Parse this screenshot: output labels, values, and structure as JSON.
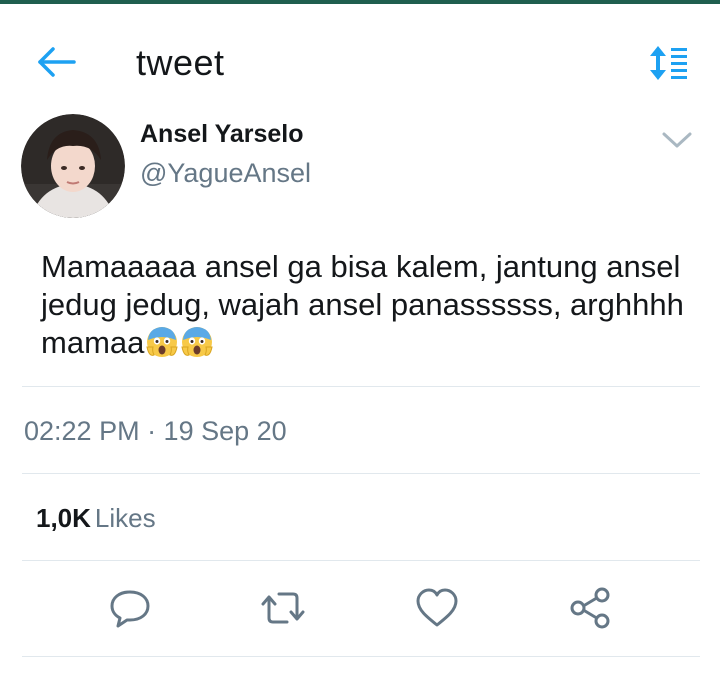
{
  "app_bar": {
    "title": "tweet",
    "back_icon": "arrow-left-icon",
    "sort_icon": "sort-list-icon",
    "accent_color": "#1da1f2"
  },
  "tweet": {
    "author_name": "Ansel Yarselo",
    "author_handle": "@YagueAnsel",
    "text": "Mamaaaaa ansel ga bisa kalem, jantung ansel jedug jedug, wajah ansel panassssss, arghhhh mamaa",
    "emojis": [
      "face-screaming-in-fear",
      "face-screaming-in-fear"
    ],
    "timestamp": "02:22 PM · 19 Sep 20",
    "likes_count": "1,0K",
    "likes_label": "Likes"
  },
  "actions": [
    {
      "name": "reply",
      "icon": "reply-icon"
    },
    {
      "name": "retweet",
      "icon": "retweet-icon"
    },
    {
      "name": "like",
      "icon": "heart-icon"
    },
    {
      "name": "share",
      "icon": "share-icon"
    }
  ],
  "colors": {
    "text_primary": "#14171a",
    "text_secondary": "#657786",
    "divider": "#e1e8ed",
    "status_strip": "#1f5f4f"
  }
}
